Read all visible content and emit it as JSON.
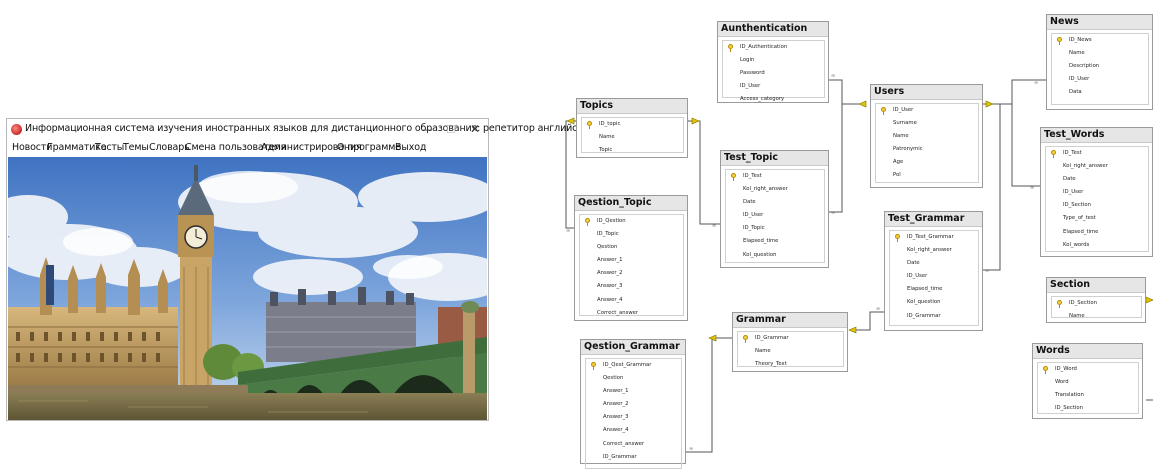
{
  "app": {
    "title": "Информационная система изучения иностранных языков для дистанционного образования: репетитор английског...",
    "controls": {
      "minimize": "—",
      "maximize": "☐",
      "close": "✕"
    },
    "menu": [
      "Новости",
      "Грамматика",
      "Тесты",
      "Темы",
      "Словарь",
      "Смена пользователя",
      "Администрирования",
      "О программе",
      "Выход"
    ],
    "icon": "app-globe-icon",
    "image": "london-westminster-photo"
  },
  "diagram": {
    "tables": [
      {
        "name": "Aunthentication",
        "fields": [
          "ID_Authentication",
          "Login",
          "Password",
          "ID_User",
          "Access_category"
        ]
      },
      {
        "name": "News",
        "fields": [
          "ID_News",
          "Name",
          "Description",
          "ID_User",
          "Data"
        ]
      },
      {
        "name": "Topics",
        "fields": [
          "ID_topic",
          "Name",
          "Topic"
        ]
      },
      {
        "name": "Users",
        "fields": [
          "ID_User",
          "Surname",
          "Name",
          "Patronymic",
          "Age",
          "Pol"
        ]
      },
      {
        "name": "Test_Words",
        "fields": [
          "ID_Test",
          "Kol_right_answer",
          "Date",
          "ID_User",
          "ID_Section",
          "Type_of_test",
          "Elapsed_time",
          "Kol_words"
        ]
      },
      {
        "name": "Test_Topic",
        "fields": [
          "ID_Test",
          "Kol_right_answer",
          "Date",
          "ID_User",
          "ID_Topic",
          "Elapsed_time",
          "Kol_question"
        ]
      },
      {
        "name": "Qestion_Topic",
        "fields": [
          "ID_Qestion",
          "ID_Topic",
          "Qestion",
          "Answer_1",
          "Answer_2",
          "Answer_3",
          "Answer_4",
          "Correct_answer"
        ]
      },
      {
        "name": "Test_Grammar",
        "fields": [
          "ID_Test_Grammar",
          "Kol_right_answer",
          "Date",
          "ID_User",
          "Elapsed_time",
          "Kol_question",
          "ID_Grammar"
        ]
      },
      {
        "name": "Section",
        "fields": [
          "ID_Section",
          "Name"
        ]
      },
      {
        "name": "Grammar",
        "fields": [
          "ID_Grammar",
          "Name",
          "Theory_Text"
        ]
      },
      {
        "name": "Qestion_Grammar",
        "fields": [
          "ID_Qest_Grammar",
          "Qestion",
          "Answer_1",
          "Answer_2",
          "Answer_3",
          "Answer_4",
          "Correct_answer",
          "ID_Grammar"
        ]
      },
      {
        "name": "Words",
        "fields": [
          "ID_Word",
          "Word",
          "Translation",
          "ID_Section"
        ]
      }
    ]
  }
}
